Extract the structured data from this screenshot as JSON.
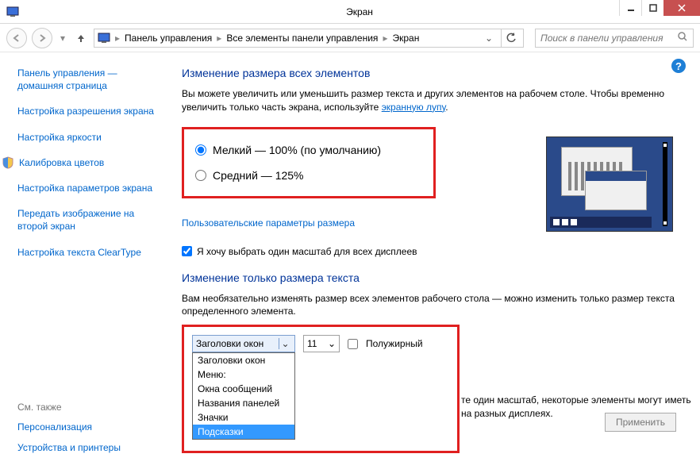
{
  "window": {
    "title": "Экран"
  },
  "breadcrumb": {
    "seg1": "Панель управления",
    "seg2": "Все элементы панели управления",
    "seg3": "Экран"
  },
  "search": {
    "placeholder": "Поиск в панели управления"
  },
  "sidebar": {
    "items": [
      "Панель управления — домашняя страница",
      "Настройка разрешения экрана",
      "Настройка яркости",
      "Калибровка цветов",
      "Настройка параметров экрана",
      "Передать изображение на второй экран",
      "Настройка текста ClearType"
    ]
  },
  "seealso": {
    "heading": "См. также",
    "items": [
      "Персонализация",
      "Устройства и принтеры"
    ]
  },
  "main": {
    "h1": "Изменение размера всех элементов",
    "desc1a": "Вы можете увеличить или уменьшить размер текста и других элементов на рабочем столе. Чтобы временно увеличить только часть экрана, используйте ",
    "desc1link": "экранную лупу",
    "desc1b": ".",
    "radio_small": "Мелкий — 100% (по умолчанию)",
    "radio_medium": "Средний — 125%",
    "custom_link": "Пользовательские параметры размера",
    "chk_label": "Я хочу выбрать один масштаб для всех дисплеев",
    "h2": "Изменение только размера текста",
    "desc2": "Вам необязательно изменять размер всех элементов рабочего стола — можно изменить только размер текста определенного элемента.",
    "element_selected": "Заголовки окон",
    "element_options": [
      "Заголовки окон",
      "Меню:",
      "Окна сообщений",
      "Названия панелей",
      "Значки",
      "Подсказки"
    ],
    "font_size": "11",
    "bold_label": "Полужирный",
    "note_a": "те один масштаб, некоторые элементы могут иметь ",
    "note_b": "на разных дисплеях.",
    "apply": "Применить"
  }
}
